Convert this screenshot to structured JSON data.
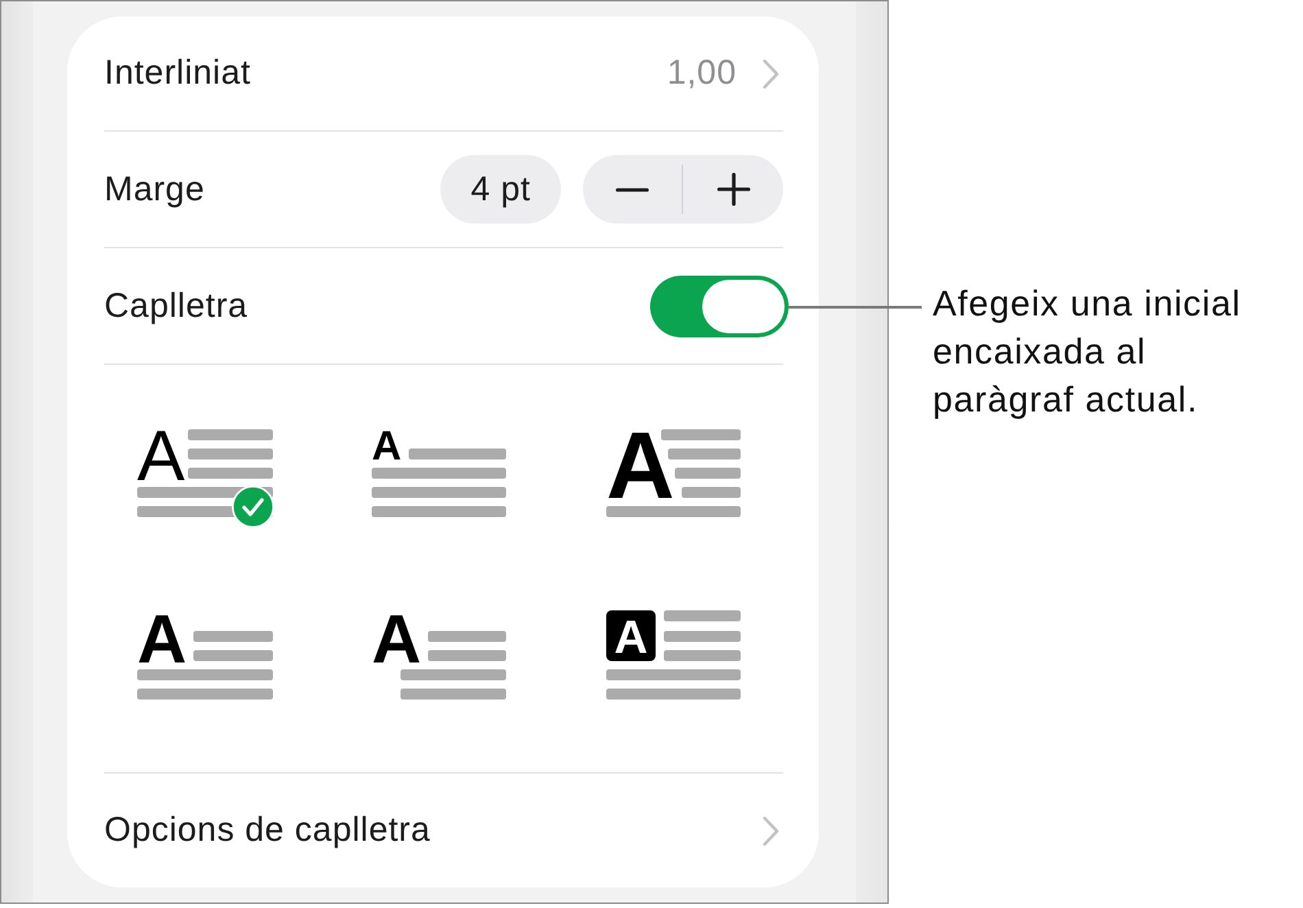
{
  "rows": [
    {
      "kind": "disclosure",
      "label": "Interliniat",
      "value": "1,00"
    },
    {
      "kind": "stepper",
      "label": "Marge",
      "value": "4 pt"
    },
    {
      "kind": "toggle",
      "label": "Caplletra",
      "on": true
    }
  ],
  "drop_cap_styles": [
    {
      "kind": "standard",
      "letter": "A",
      "selected": true
    },
    {
      "kind": "raised",
      "letter": "A",
      "selected": false
    },
    {
      "kind": "tall",
      "letter": "A",
      "selected": false
    },
    {
      "kind": "bold",
      "letter": "A",
      "selected": false
    },
    {
      "kind": "hanging",
      "letter": "A",
      "selected": false
    },
    {
      "kind": "boxed",
      "letter": "A",
      "selected": false
    }
  ],
  "options_row": {
    "label": "Opcions de caplletra"
  },
  "callout": {
    "text": "Afegeix una inicial encaixada al paràgraf actual."
  }
}
